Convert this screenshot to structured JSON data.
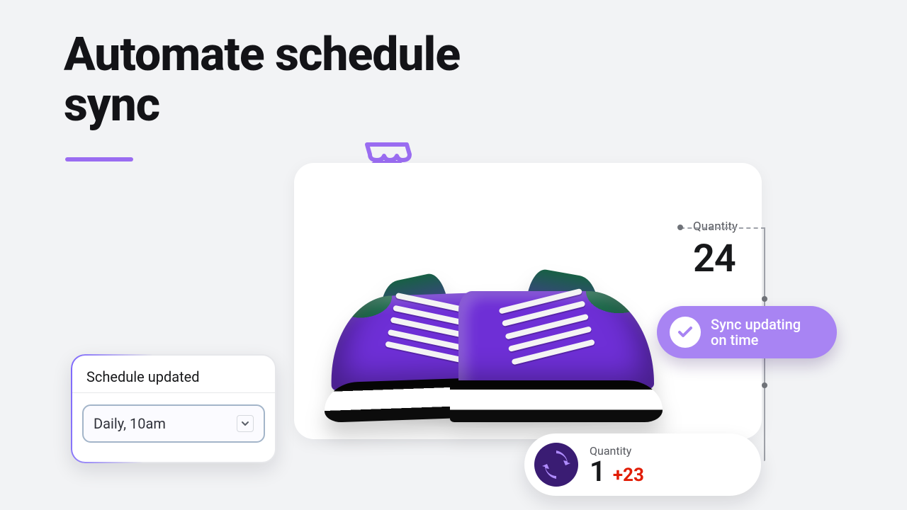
{
  "title_line1": "Automate schedule",
  "title_line2": "sync",
  "product": {
    "qty_label": "Quantity",
    "qty_value": "24"
  },
  "schedule": {
    "heading": "Schedule updated",
    "selected": "Daily, 10am"
  },
  "sync_pill": {
    "text": "Sync updating on time"
  },
  "qty2": {
    "label": "Quantity",
    "value": "1",
    "delta": "+23"
  },
  "colors": {
    "accent": "#9a6cf1",
    "delta_red": "#e11d06"
  }
}
